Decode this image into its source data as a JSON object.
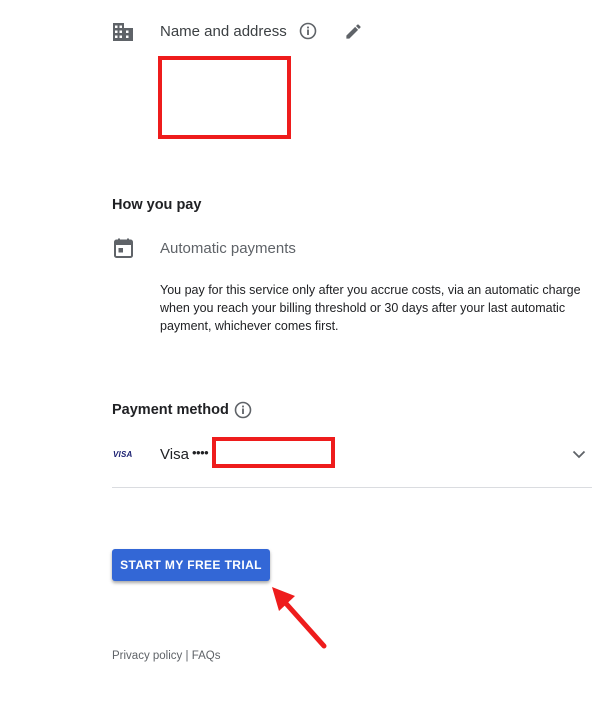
{
  "name_address": {
    "label": "Name and address",
    "icons": [
      "building-icon",
      "info-icon",
      "edit-pencil-icon"
    ]
  },
  "how_you_pay": {
    "heading": "How you pay",
    "method_title": "Automatic payments",
    "description": "You pay for this service only after you accrue costs, via an automatic charge when you reach your billing threshold or 30 days after your last automatic payment, whichever comes first.",
    "icon": "calendar-icon"
  },
  "payment_method": {
    "heading": "Payment method",
    "card_brand_logo": "VISA",
    "card_label": "Visa",
    "card_mask": "••••",
    "icons": [
      "info-icon",
      "chevron-down-icon"
    ]
  },
  "cta": {
    "label": "START MY FREE TRIAL"
  },
  "footer": {
    "privacy": "Privacy policy",
    "separator": "|",
    "faqs": "FAQs"
  },
  "colors": {
    "primary_button": "#3367d6",
    "annotation_red": "#ee1c1c",
    "icon_gray": "#5f6368"
  }
}
